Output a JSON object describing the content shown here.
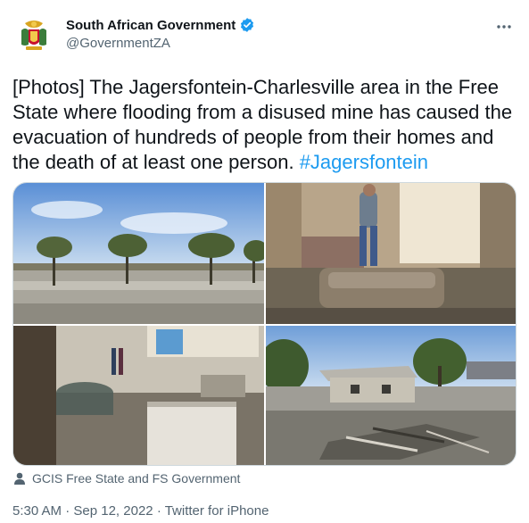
{
  "author": {
    "display_name": "South African Government",
    "handle": "@GovernmentZA",
    "verified": true,
    "avatar_icon": "coat-of-arms-icon"
  },
  "tweet": {
    "text": "[Photos] The Jagersfontein-Charlesville area in the Free State where flooding from a disused mine has caused the evacuation of hundreds of people from their homes and the death of at least one person. ",
    "hashtag": "#Jagersfontein"
  },
  "media": {
    "photos": [
      {
        "subject": "flooded-field-with-trees"
      },
      {
        "subject": "man-in-mud-covered-room-with-sofa"
      },
      {
        "subject": "mud-filled-kitchen"
      },
      {
        "subject": "house-surrounded-by-mud-and-debris"
      }
    ],
    "credit": "GCIS Free State and FS Government"
  },
  "meta": {
    "time": "5:30 AM",
    "separator": "·",
    "date": "Sep 12, 2022",
    "source": "Twitter for iPhone"
  },
  "colors": {
    "link": "#1d9bf0",
    "secondary_text": "#536471",
    "primary_text": "#0f1419",
    "verified_badge": "#1d9bf0"
  }
}
